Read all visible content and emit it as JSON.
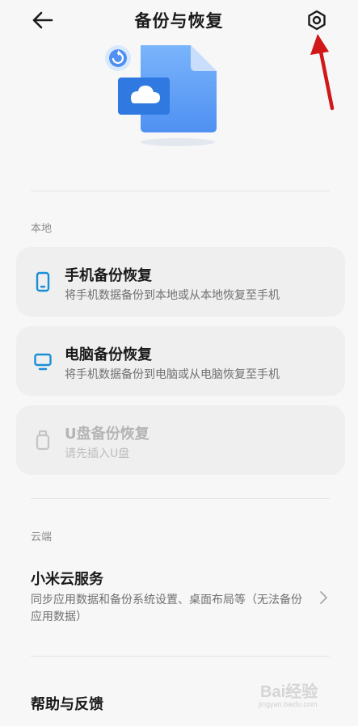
{
  "header": {
    "title": "备份与恢复",
    "back_icon": "arrow-left-icon",
    "settings_icon": "gear-icon"
  },
  "sections": {
    "local_label": "本地",
    "cloud_label": "云端"
  },
  "local_items": [
    {
      "title": "手机备份恢复",
      "subtitle": "将手机数据备份到本地或从本地恢复至手机",
      "icon": "phone-icon",
      "enabled": true
    },
    {
      "title": "电脑备份恢复",
      "subtitle": "将手机数据备份到电脑或从电脑恢复至手机",
      "icon": "monitor-icon",
      "enabled": true
    },
    {
      "title": "U盘备份恢复",
      "subtitle": "请先插入U盘",
      "icon": "usb-drive-icon",
      "enabled": false
    }
  ],
  "cloud_item": {
    "title": "小米云服务",
    "subtitle": "同步应用数据和备份系统设置、桌面布局等（无法备份应用数据）"
  },
  "help": {
    "title": "帮助与反馈"
  },
  "watermark": {
    "text": "Bai经验",
    "subtext": "jingyan.baidu.com"
  },
  "colors": {
    "accent": "#1a8fd8",
    "file_blue": "#5a9df5",
    "annotation_red": "#d01818"
  }
}
